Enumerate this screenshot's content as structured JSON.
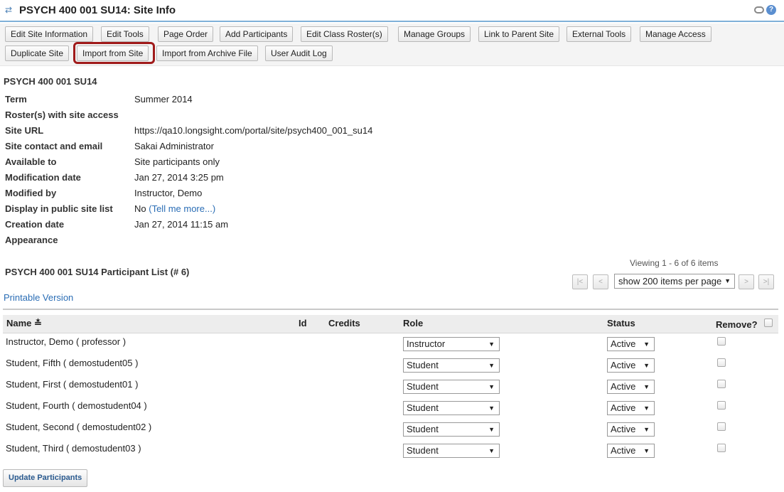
{
  "header": {
    "title": "PSYCH 400 001 SU14: Site Info",
    "reset_icon": "reset-icon",
    "link_icon": "link-icon",
    "help_icon": "help-icon",
    "help_glyph": "?"
  },
  "toolbar": {
    "edit_site_information": "Edit Site Information",
    "edit_tools": "Edit Tools",
    "page_order": "Page Order",
    "add_participants": "Add Participants",
    "edit_class_rosters": "Edit Class Roster(s)",
    "manage_groups": "Manage Groups",
    "link_to_parent_site": "Link to Parent Site",
    "external_tools": "External Tools",
    "manage_access": "Manage Access",
    "duplicate_site": "Duplicate Site",
    "import_from_site": "Import from Site",
    "import_from_archive": "Import from Archive File",
    "user_audit_log": "User Audit Log",
    "highlight_color": "#a01b1b"
  },
  "site": {
    "heading": "PSYCH 400 001 SU14",
    "term_label": "Term",
    "term_value": "Summer 2014",
    "rosters_label": "Roster(s) with site access",
    "rosters_value": "",
    "url_label": "Site URL",
    "url_value": "https://qa10.longsight.com/portal/site/psych400_001_su14",
    "contact_label": "Site contact and email",
    "contact_value": "Sakai Administrator",
    "available_label": "Available to",
    "available_value": "Site participants only",
    "modification_label": "Modification date",
    "modification_value": "Jan 27, 2014 3:25 pm",
    "modified_by_label": "Modified by",
    "modified_by_value": "Instructor, Demo",
    "public_label": "Display in public site list",
    "public_value": "No",
    "public_link": "(Tell me more...)",
    "creation_label": "Creation date",
    "creation_value": "Jan 27, 2014 11:15 am",
    "appearance_label": "Appearance"
  },
  "participants": {
    "title": "PSYCH 400 001 SU14 Participant List (# 6)",
    "viewing": "Viewing 1 - 6 of 6 items",
    "page_size": "show 200 items per page",
    "first_glyph": "|<",
    "prev_glyph": "<",
    "next_glyph": ">",
    "last_glyph": ">|",
    "printable": "Printable Version",
    "columns": {
      "name": "Name",
      "sort_glyph": "≛",
      "id": "Id",
      "credits": "Credits",
      "role": "Role",
      "status": "Status",
      "remove": "Remove?"
    },
    "rows": [
      {
        "name": "Instructor, Demo ( professor )",
        "role": "Instructor",
        "status": "Active"
      },
      {
        "name": "Student, Fifth ( demostudent05 )",
        "role": "Student",
        "status": "Active"
      },
      {
        "name": "Student, First ( demostudent01 )",
        "role": "Student",
        "status": "Active"
      },
      {
        "name": "Student, Fourth ( demostudent04 )",
        "role": "Student",
        "status": "Active"
      },
      {
        "name": "Student, Second ( demostudent02 )",
        "role": "Student",
        "status": "Active"
      },
      {
        "name": "Student, Third ( demostudent03 )",
        "role": "Student",
        "status": "Active"
      }
    ],
    "update_button": "Update Participants"
  }
}
